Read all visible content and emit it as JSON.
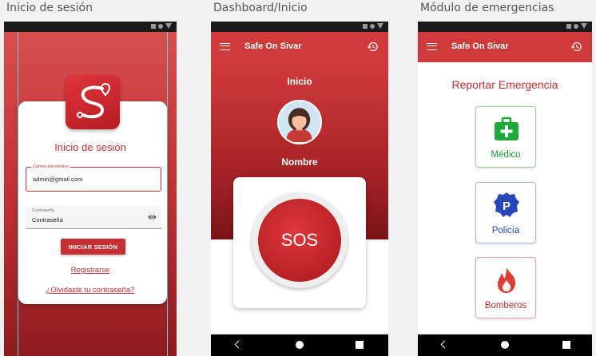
{
  "screens": {
    "login": {
      "caption": "Inicio de sesión",
      "title": "Inicio de sesión",
      "email_label": "Correo electrónico",
      "email_value": "admin@gmail.com",
      "password_label": "Contraseña",
      "password_value": "Contraseña",
      "login_button": "INICIAR SESIÓN",
      "register_link": "Registrarse",
      "forgot_link": "¿Olvidaste tu contraseña?"
    },
    "dashboard": {
      "caption": "Dashboard/Inicio",
      "app_title": "Safe On Sivar",
      "heading": "Inicio",
      "user_name": "Nombre",
      "sos_label": "SOS"
    },
    "emergencies": {
      "caption": "Módulo de emergencias",
      "app_title": "Safe On Sivar",
      "heading": "Reportar Emergencia",
      "options": [
        {
          "label": "Médico",
          "icon": "first-aid-kit-icon"
        },
        {
          "label": "Policía",
          "icon": "police-badge-icon"
        },
        {
          "label": "Bomberos",
          "icon": "fire-icon"
        }
      ]
    }
  },
  "colors": {
    "brand_red": "#d03a3b",
    "dark_red": "#7a1419",
    "medico_green": "#1b9a33",
    "policia_blue": "#2747b8"
  }
}
